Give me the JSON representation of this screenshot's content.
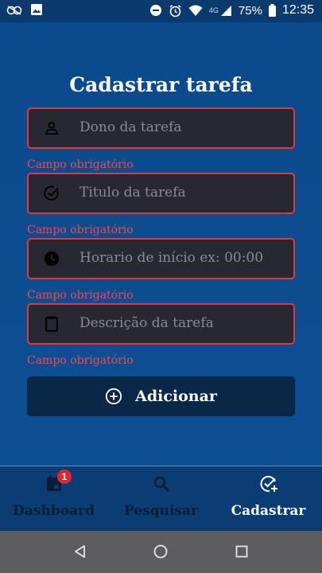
{
  "status_bar": {
    "battery": "75%",
    "clock": "12:35",
    "network": "4G"
  },
  "page": {
    "title": "Cadastrar tarefa"
  },
  "form": {
    "fields": [
      {
        "icon": "person-icon",
        "placeholder": "Dono da tarefa",
        "error": "Campo obrigatório"
      },
      {
        "icon": "check-circle-icon",
        "placeholder": "Titulo da tarefa",
        "error": "Campo obrigatório"
      },
      {
        "icon": "clock-icon",
        "placeholder": "Horario de início ex: 00:00",
        "error": "Campo obrigatório"
      },
      {
        "icon": "clipboard-icon",
        "placeholder": "Descrição da tarefa",
        "error": "Campo obrigatório"
      }
    ],
    "submit_label": "Adicionar"
  },
  "bottom_nav": {
    "items": [
      {
        "label": "Dashboard",
        "icon": "calendar-icon",
        "badge": "1"
      },
      {
        "label": "Pesquisar",
        "icon": "search-icon"
      },
      {
        "label": "Cadastrar",
        "icon": "add-task-icon",
        "active": true
      }
    ]
  },
  "colors": {
    "background": "#0b4a8c",
    "field_bg": "#282833",
    "error": "#e0383c",
    "button_bg": "#0a2748",
    "nav_bg": "#0b3d74"
  }
}
